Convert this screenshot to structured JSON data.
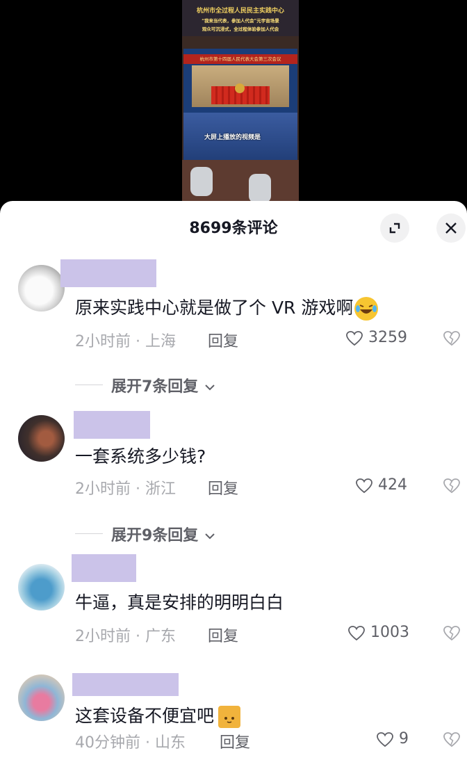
{
  "video": {
    "caption_line1": "杭州市全过程人民民主实践中心",
    "caption_line2": "“我来当代表，参加人代会”元宇宙场景",
    "caption_line3": "观众可沉浸式，全过程体验参加人代会",
    "screen_banner": "杭州市第十四届人民代表大会第三次会议",
    "subtitle": "大屏上播放的视频是"
  },
  "panel": {
    "title": "8699条评论",
    "expand_icon": "collapse-arrows-icon",
    "close_icon": "close-icon"
  },
  "comments": [
    {
      "text": "原来实践中心就是做了个 VR 游戏啊",
      "time": "2小时前",
      "location": "上海",
      "reply_label": "回复",
      "likes": "3259",
      "expand_label": "展开7条回复",
      "emoji": "laughing-tears-icon",
      "avatar_colors": [
        "#d8d8d8",
        "#f5f5f5"
      ]
    },
    {
      "text": "一套系统多少钱?",
      "time": "2小时前",
      "location": "浙江",
      "reply_label": "回复",
      "likes": "424",
      "expand_label": "展开9条回复",
      "avatar_colors": [
        "#2a2a3a",
        "#8a4a3a"
      ]
    },
    {
      "text": "牛逼，真是安排的明明白白",
      "time": "2小时前",
      "location": "广东",
      "reply_label": "回复",
      "likes": "1003",
      "avatar_colors": [
        "#e8eef2",
        "#5aa0c8"
      ]
    },
    {
      "text": "这套设备不便宜吧",
      "time": "40分钟前",
      "location": "山东",
      "reply_label": "回复",
      "likes": "9",
      "emoji": "cat-icon",
      "avatar_colors": [
        "#d8c7b8",
        "#e07090"
      ]
    }
  ],
  "colors": {
    "username_placeholder": "#cbc3e9",
    "text_primary": "#161823",
    "text_meta": "#a7a8ad",
    "text_action": "#5f6067"
  }
}
